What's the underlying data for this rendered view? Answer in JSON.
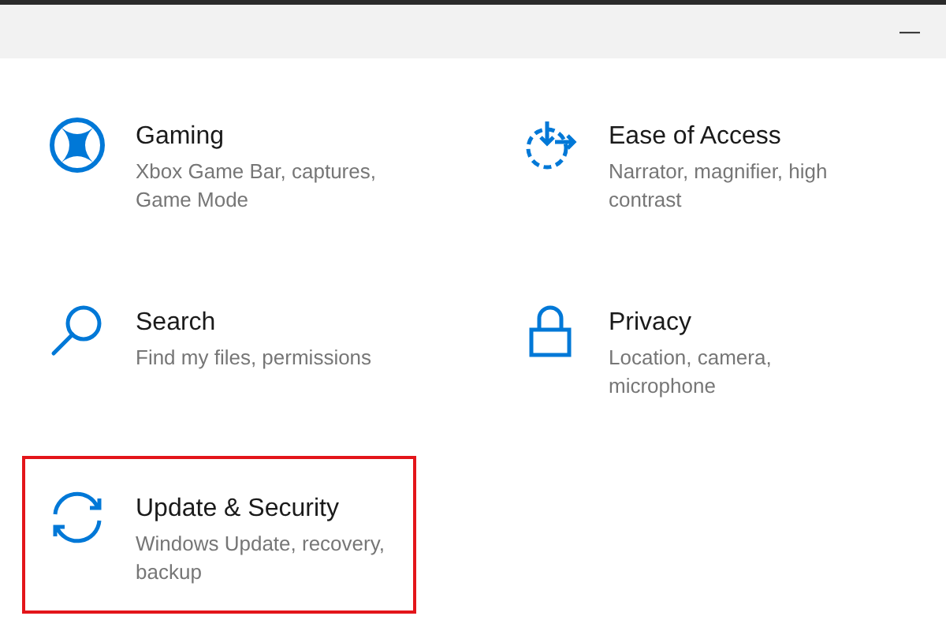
{
  "window": {
    "minimize_button": "—"
  },
  "tiles": [
    {
      "title": "Gaming",
      "description": "Xbox Game Bar, captures, Game Mode",
      "highlighted": false
    },
    {
      "title": "Ease of Access",
      "description": "Narrator, magnifier, high contrast",
      "highlighted": false
    },
    {
      "title": "Search",
      "description": "Find my files, permissions",
      "highlighted": false
    },
    {
      "title": "Privacy",
      "description": "Location, camera, microphone",
      "highlighted": false
    },
    {
      "title": "Update & Security",
      "description": "Windows Update, recovery, backup",
      "highlighted": true
    }
  ]
}
